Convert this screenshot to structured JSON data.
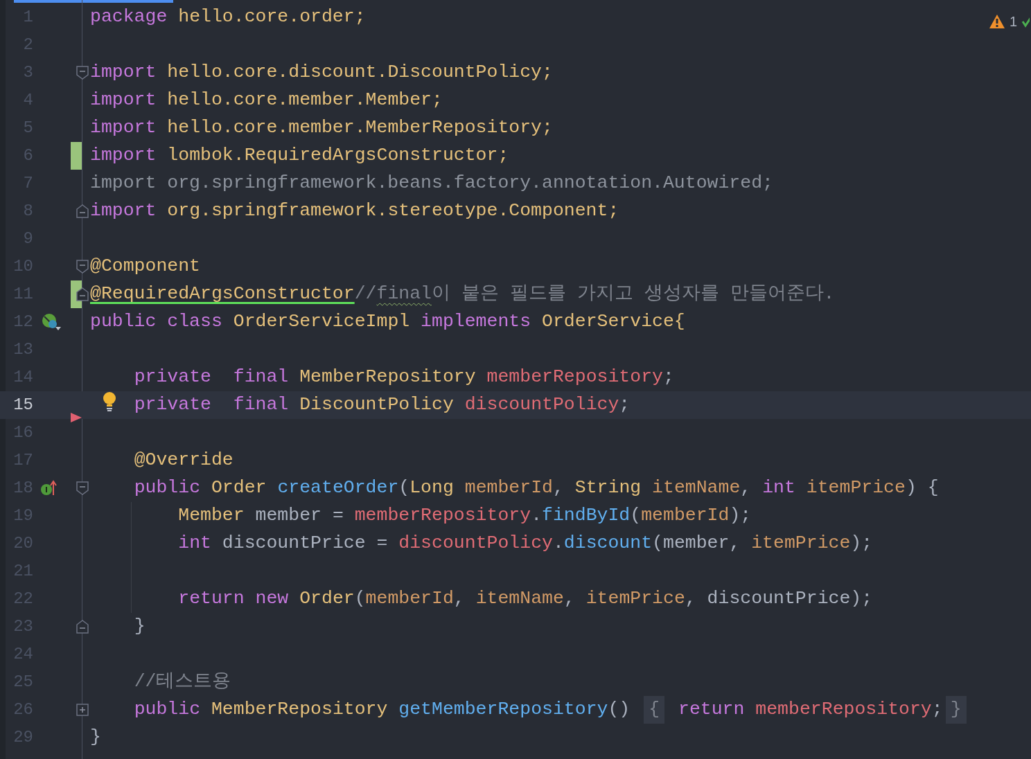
{
  "problems": {
    "warnings": "1"
  },
  "lines": [
    {
      "number": "1",
      "tokens": [
        {
          "text": "package",
          "kind": "keyword"
        },
        {
          "text": " hello.core.order;",
          "kind": "type"
        }
      ]
    },
    {
      "number": "2"
    },
    {
      "number": "3",
      "fold_start": true,
      "tokens": [
        {
          "text": "import",
          "kind": "keyword"
        },
        {
          "text": " hello.core.discount.DiscountPolicy;",
          "kind": "type"
        }
      ]
    },
    {
      "number": "4",
      "tokens": [
        {
          "text": "import",
          "kind": "keyword"
        },
        {
          "text": " hello.core.member.Member;",
          "kind": "type"
        }
      ]
    },
    {
      "number": "5",
      "tokens": [
        {
          "text": "import",
          "kind": "keyword"
        },
        {
          "text": " hello.core.member.MemberRepository;",
          "kind": "type"
        }
      ]
    },
    {
      "number": "6",
      "changed": true,
      "tokens": [
        {
          "text": "import",
          "kind": "keyword"
        },
        {
          "text": " lombok.RequiredArgsConstructor;",
          "kind": "type"
        }
      ]
    },
    {
      "number": "7",
      "tokens": [
        {
          "text": "import org.springframework.beans.factory.annotation.Autowired;",
          "kind": "unused"
        }
      ]
    },
    {
      "number": "8",
      "fold_end": true,
      "tokens": [
        {
          "text": "import",
          "kind": "keyword"
        },
        {
          "text": " org.springframework.stereotype.Component;",
          "kind": "type"
        }
      ]
    },
    {
      "number": "9"
    },
    {
      "number": "10",
      "fold_start": true,
      "tokens": [
        {
          "text": "@Component",
          "kind": "annotation"
        }
      ]
    },
    {
      "number": "11",
      "changed": true,
      "fold_end": true,
      "tokens": [
        {
          "text": "@RequiredArgsConstructor",
          "kind": "annotation",
          "underlined": true
        },
        {
          "text": "//",
          "kind": "comment"
        },
        {
          "text": "final",
          "kind": "comment",
          "typo": true
        },
        {
          "text": "이 붙은 필드를 가지고 생성자를 만들어준다.",
          "kind": "comment"
        }
      ]
    },
    {
      "number": "12",
      "bean_marker": true,
      "tokens": [
        {
          "text": "public class",
          "kind": "keyword"
        },
        {
          "text": " OrderServiceImpl ",
          "kind": "type"
        },
        {
          "text": "implements",
          "kind": "keyword"
        },
        {
          "text": " OrderService{",
          "kind": "type"
        }
      ]
    },
    {
      "number": "13"
    },
    {
      "number": "14",
      "tokens": [
        {
          "text": "    private  final",
          "kind": "keyword"
        },
        {
          "text": " MemberRepository ",
          "kind": "type"
        },
        {
          "text": "memberRepository",
          "kind": "field"
        },
        {
          "text": ";",
          "kind": "plain"
        }
      ]
    },
    {
      "number": "15",
      "current": true,
      "bulb": true,
      "run_marker": true,
      "tokens": [
        {
          "text": "    private  final",
          "kind": "keyword"
        },
        {
          "text": " DiscountPolicy ",
          "kind": "type"
        },
        {
          "text": "discountPolicy",
          "kind": "field"
        },
        {
          "text": ";",
          "kind": "plain"
        }
      ]
    },
    {
      "number": "16"
    },
    {
      "number": "17",
      "tokens": [
        {
          "text": "    @Override",
          "kind": "annotation"
        }
      ]
    },
    {
      "number": "18",
      "implements_marker": true,
      "fold_start": true,
      "tokens": [
        {
          "text": "    public",
          "kind": "keyword"
        },
        {
          "text": " Order ",
          "kind": "type"
        },
        {
          "text": "createOrder",
          "kind": "method"
        },
        {
          "text": "(",
          "kind": "plain"
        },
        {
          "text": "Long ",
          "kind": "type"
        },
        {
          "text": "memberId",
          "kind": "param"
        },
        {
          "text": ", ",
          "kind": "plain"
        },
        {
          "text": "String ",
          "kind": "type"
        },
        {
          "text": "itemName",
          "kind": "param"
        },
        {
          "text": ", ",
          "kind": "plain"
        },
        {
          "text": "int ",
          "kind": "keyword"
        },
        {
          "text": "itemPrice",
          "kind": "param"
        },
        {
          "text": ") {",
          "kind": "plain"
        }
      ]
    },
    {
      "number": "19",
      "guide": true,
      "tokens": [
        {
          "text": "        Member ",
          "kind": "type"
        },
        {
          "text": "member = ",
          "kind": "plain"
        },
        {
          "text": "memberRepository",
          "kind": "field"
        },
        {
          "text": ".",
          "kind": "plain"
        },
        {
          "text": "findById",
          "kind": "method"
        },
        {
          "text": "(",
          "kind": "plain"
        },
        {
          "text": "memberId",
          "kind": "param"
        },
        {
          "text": ");",
          "kind": "plain"
        }
      ]
    },
    {
      "number": "20",
      "guide": true,
      "tokens": [
        {
          "text": "        int",
          "kind": "keyword"
        },
        {
          "text": " discountPrice = ",
          "kind": "plain"
        },
        {
          "text": "discountPolicy",
          "kind": "field"
        },
        {
          "text": ".",
          "kind": "plain"
        },
        {
          "text": "discount",
          "kind": "method"
        },
        {
          "text": "(member, ",
          "kind": "plain"
        },
        {
          "text": "itemPrice",
          "kind": "param"
        },
        {
          "text": ");",
          "kind": "plain"
        }
      ]
    },
    {
      "number": "21",
      "guide": true
    },
    {
      "number": "22",
      "guide": true,
      "tokens": [
        {
          "text": "        return new",
          "kind": "keyword"
        },
        {
          "text": " Order",
          "kind": "type"
        },
        {
          "text": "(",
          "kind": "plain"
        },
        {
          "text": "memberId",
          "kind": "param"
        },
        {
          "text": ", ",
          "kind": "plain"
        },
        {
          "text": "itemName",
          "kind": "param"
        },
        {
          "text": ", ",
          "kind": "plain"
        },
        {
          "text": "itemPrice",
          "kind": "param"
        },
        {
          "text": ", discountPrice);",
          "kind": "plain"
        }
      ]
    },
    {
      "number": "23",
      "fold_end": true,
      "tokens": [
        {
          "text": "    }",
          "kind": "plain"
        }
      ]
    },
    {
      "number": "24"
    },
    {
      "number": "25",
      "tokens": [
        {
          "text": "    //테스트용",
          "kind": "comment"
        }
      ]
    },
    {
      "number": "26",
      "collapsed": true,
      "tokens": [
        {
          "text": "    public",
          "kind": "keyword"
        },
        {
          "text": " MemberRepository ",
          "kind": "type"
        },
        {
          "text": "getMemberRepository",
          "kind": "method"
        },
        {
          "text": "() ",
          "kind": "plain"
        },
        {
          "text": "{",
          "kind": "folded"
        },
        {
          "text": " return",
          "kind": "keyword"
        },
        {
          "text": " memberRepository",
          "kind": "field"
        },
        {
          "text": ";",
          "kind": "plain"
        },
        {
          "text": "}",
          "kind": "folded"
        }
      ]
    },
    {
      "number": "29",
      "tokens": [
        {
          "text": "}",
          "kind": "plain"
        }
      ]
    }
  ]
}
